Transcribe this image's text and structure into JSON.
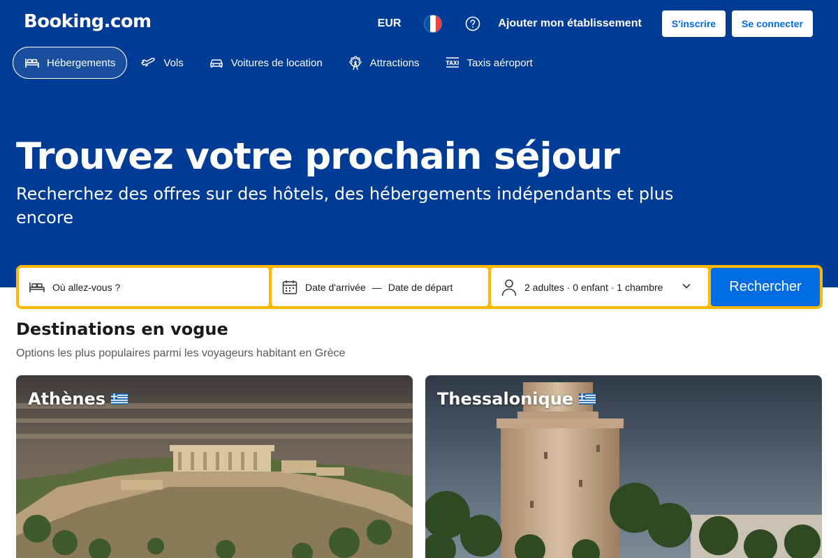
{
  "header": {
    "logo": "Booking.com",
    "currency": "EUR",
    "list_property": "Ajouter mon établissement",
    "register": "S'inscrire",
    "sign_in": "Se connecter"
  },
  "nav": {
    "items": [
      {
        "label": "Hébergements",
        "icon": "bed-icon",
        "active": true
      },
      {
        "label": "Vols",
        "icon": "plane-icon"
      },
      {
        "label": "Voitures de location",
        "icon": "car-icon"
      },
      {
        "label": "Attractions",
        "icon": "attractions-icon"
      },
      {
        "label": "Taxis aéroport",
        "icon": "taxi-icon"
      }
    ]
  },
  "hero": {
    "title": "Trouvez votre prochain séjour",
    "subtitle": "Recherchez des offres sur des hôtels, des hébergements indépendants et plus encore"
  },
  "search": {
    "destination_placeholder": "Où allez-vous ?",
    "checkin": "Date d'arrivée",
    "dash": "—",
    "checkout": "Date de départ",
    "guests": "2 adultes · 0 enfant · 1 chambre",
    "button": "Rechercher"
  },
  "trending": {
    "title": "Destinations en vogue",
    "subtitle": "Options les plus populaires parmi les voyageurs habitant en Grèce",
    "cards": [
      {
        "city": "Athènes"
      },
      {
        "city": "Thessalonique"
      }
    ]
  },
  "colors": {
    "brand": "#003b95",
    "accent": "#006ce4",
    "search_border": "#ffb700"
  }
}
